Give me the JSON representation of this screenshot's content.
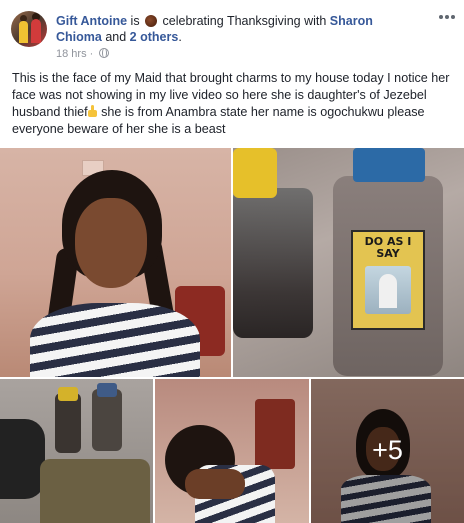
{
  "post": {
    "author": "Gift Antoine",
    "is_text": "is",
    "activity": "celebrating Thanksgiving with",
    "tagged": "Sharon Chioma",
    "and_text": "and",
    "others": "2 others",
    "period": ".",
    "timestamp": "18 hrs",
    "dot": "·",
    "privacy_icon": "globe-icon",
    "body_part1": "This is the face of my Maid that brought charms to my house today I notice her face was not showing in my live video so here she is daughter's of Jezebel husband thief",
    "body_part2": "she is from Anambra state her name is ogochukwu please everyone beware of her she is a beast"
  },
  "photos": {
    "p2_label": "DO AS I SAY",
    "more_count": "+5"
  },
  "colors": {
    "link": "#365899",
    "text": "#1d2129",
    "meta": "#90949c"
  }
}
